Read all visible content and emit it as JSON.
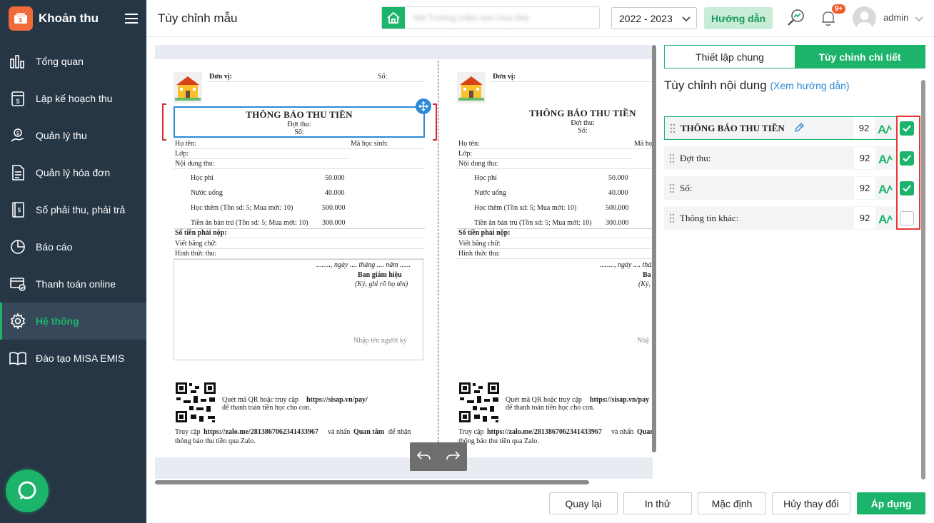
{
  "app": {
    "title": "Khoản thu"
  },
  "sidebar": {
    "items": [
      {
        "label": "Tổng quan",
        "icon": "dashboard-icon"
      },
      {
        "label": "Lập kế hoạch thu",
        "icon": "plan-icon"
      },
      {
        "label": "Quản lý thu",
        "icon": "money-hand-icon"
      },
      {
        "label": "Quản lý hóa đơn",
        "icon": "invoice-icon"
      },
      {
        "label": "Sổ phải thu, phải trả",
        "icon": "ledger-icon"
      },
      {
        "label": "Báo cáo",
        "icon": "pie-chart-icon"
      },
      {
        "label": "Thanh toán online",
        "icon": "online-payment-icon"
      },
      {
        "label": "Hệ thống",
        "icon": "gear-icon",
        "active": true
      },
      {
        "label": "Đào tạo MISA EMIS",
        "icon": "book-icon"
      }
    ]
  },
  "header": {
    "page_title": "Tùy chỉnh mẫu",
    "school_name": "Mã Trường mầm non Hoa Mai",
    "year": "2022 - 2023",
    "guide_label": "Hướng dẫn",
    "notif_badge": "9+",
    "user": "admin"
  },
  "receipt": {
    "unit_label": "Đơn vị:",
    "number_label": "Số:",
    "title": "THÔNG BÁO THU TIỀN",
    "batch_label": "Đợt thu:",
    "num_label": "Số:",
    "name_label": "Họ tên:",
    "student_code_label": "Mã học sinh:",
    "class_label": "Lớp:",
    "content_label": "Nội dung thu:",
    "fees": [
      {
        "name": "Học phí",
        "amount": "50.000"
      },
      {
        "name": "Nước uống",
        "amount": "40.000"
      },
      {
        "name": "Học thêm (Tồn sd: 5; Mua mới: 10)",
        "amount": "500.000"
      },
      {
        "name": "Tiền ăn bán trú (Tồn sd: 5; Mua mới: 10)",
        "amount": "300.000"
      }
    ],
    "amount_due_label": "Số tiền phải nộp:",
    "in_words_label": "Viết bằng chữ:",
    "payment_method_label": "Hình thức thu:",
    "date_line": "........, ngày .... tháng .... năm ......",
    "signer_title": "Ban giám hiệu",
    "signer_note": "(Ký, ghi rõ họ tên)",
    "signer_placeholder": "Nhập tên người ký",
    "qr_text_1": "Quét mã QR hoặc truy cập",
    "qr_link": "https://sisap.vn/pay/",
    "qr_text_2": "để thanh toán tiền học cho con.",
    "zalo_prefix": "Truy cập",
    "zalo_link": "https://zalo.me/2813867062341433967",
    "zalo_mid": "và nhấn",
    "zalo_action": "Quan tâm",
    "zalo_suffix": "để nhận",
    "zalo_line2": "thông báo thu tiền qua Zalo.",
    "receipt2_signer_title": "Ba",
    "receipt2_signer_note": "(Ký,",
    "receipt2_placeholder": "Nhậ",
    "receipt2_qr_link": "https://sisap.vn/pay",
    "receipt2_zalo_action": "Quan"
  },
  "panel": {
    "tabs": [
      "Thiết lập chung",
      "Tùy chỉnh chi tiết"
    ],
    "active_tab": 1,
    "heading": "Tùy chỉnh nội dung",
    "help_link": "(Xem hướng dẫn)",
    "items": [
      {
        "label": "THÔNG BÁO THU TIỀN",
        "size": "92",
        "checked": true,
        "bold": true
      },
      {
        "label": "Đợt thu:",
        "size": "92",
        "checked": true
      },
      {
        "label": "Số:",
        "size": "92",
        "checked": true
      },
      {
        "label": "Thông tin khác:",
        "size": "92",
        "checked": false
      }
    ]
  },
  "footer": {
    "back": "Quay lại",
    "print_test": "In thử",
    "default": "Mặc định",
    "cancel": "Hủy thay đổi",
    "apply": "Áp dụng"
  },
  "colors": {
    "accent": "#1cb36b",
    "sidebar": "#263645",
    "selection": "#2d89d8",
    "highlight": "#e53935"
  }
}
